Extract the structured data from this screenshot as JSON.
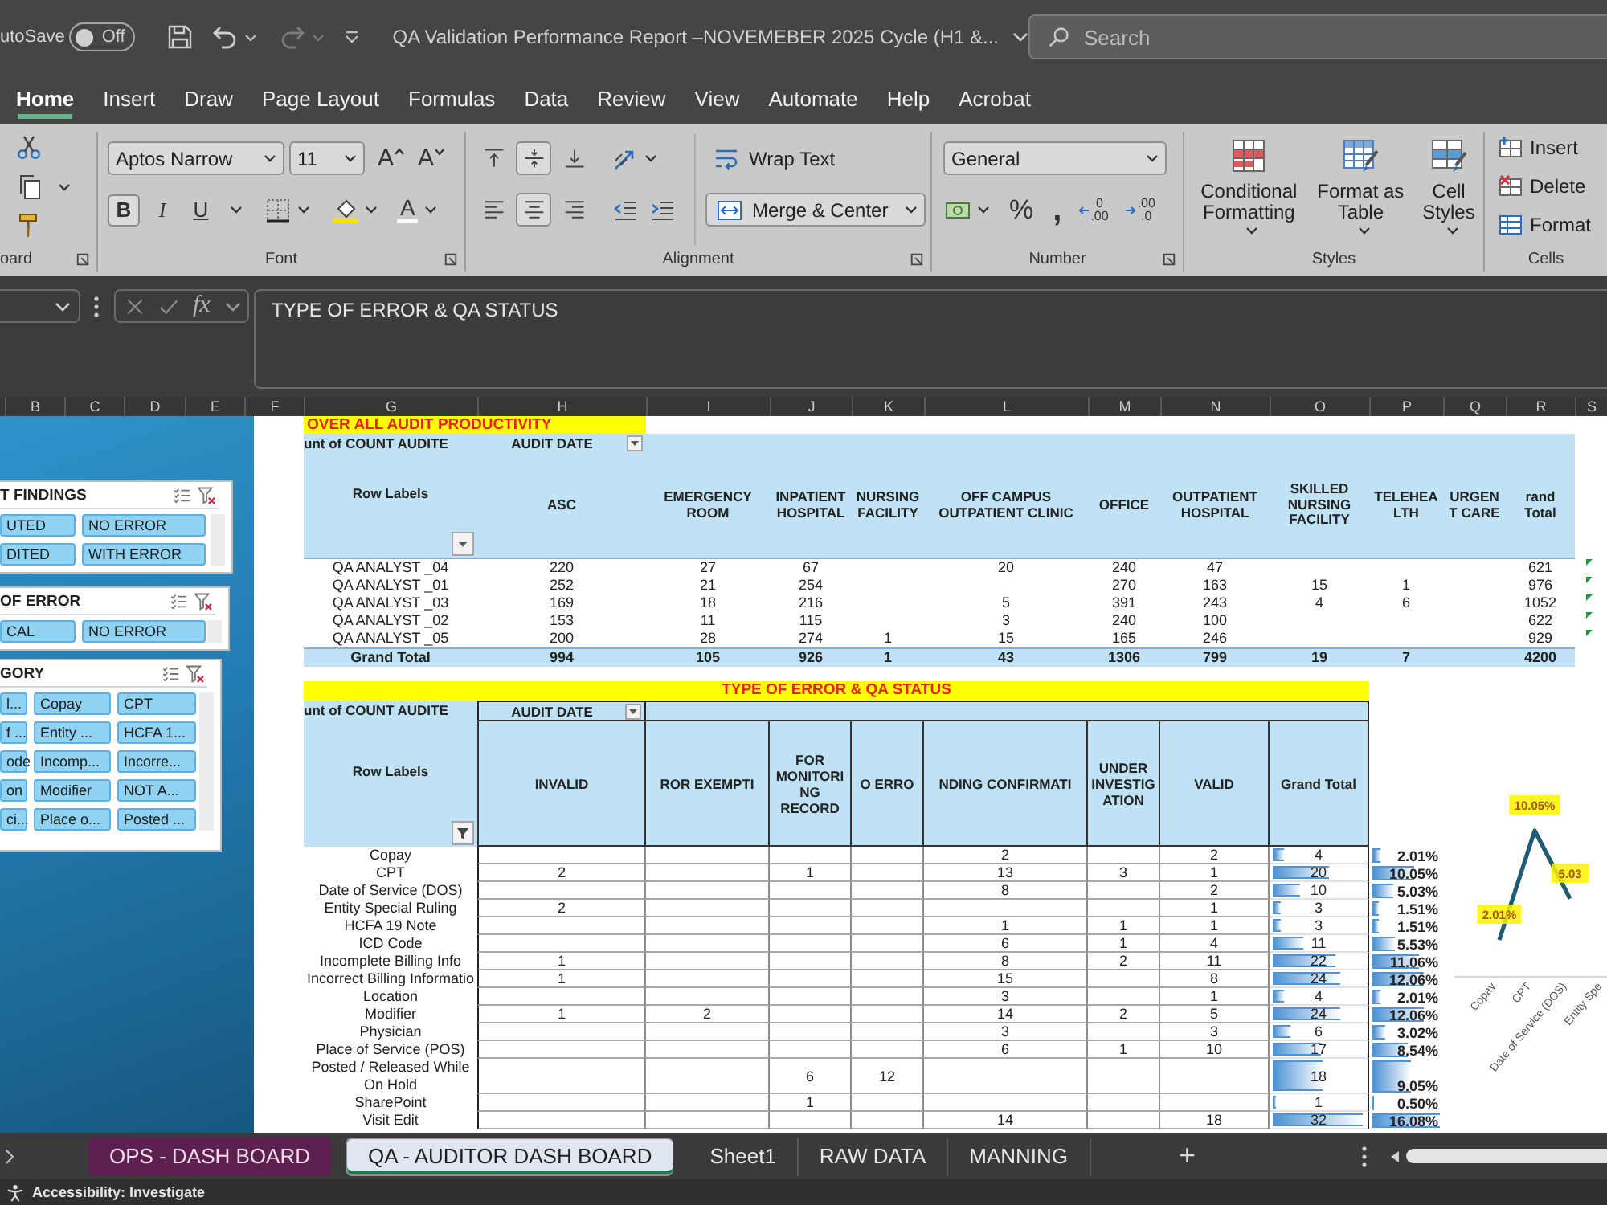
{
  "title_bar": {
    "autosave": "utoSave",
    "autosave_toggle": {
      "label": "Off",
      "on": false
    },
    "title": "QA Validation Performance Report –NOVEMEBER 2025 Cycle (H1 &...",
    "search": {
      "placeholder": "Search"
    }
  },
  "ribbon_tabs": [
    {
      "label": "Home",
      "selected": true
    },
    {
      "label": "Insert",
      "selected": false
    },
    {
      "label": "Draw",
      "selected": false
    },
    {
      "label": "Page Layout",
      "selected": false
    },
    {
      "label": "Formulas",
      "selected": false
    },
    {
      "label": "Data",
      "selected": false
    },
    {
      "label": "Review",
      "selected": false
    },
    {
      "label": "View",
      "selected": false
    },
    {
      "label": "Automate",
      "selected": false
    },
    {
      "label": "Help",
      "selected": false
    },
    {
      "label": "Acrobat",
      "selected": false
    }
  ],
  "ribbon": {
    "clipboard": {
      "label": "oard"
    },
    "font": {
      "label": "Font",
      "font_name": "Aptos Narrow",
      "font_size": "11",
      "size_buttons": [
        {
          "kind": "grow",
          "label": "A"
        },
        {
          "kind": "shrink",
          "label": "A"
        }
      ],
      "style_buttons": [
        {
          "kind": "bold",
          "label": "B",
          "selected": true
        },
        {
          "kind": "italic",
          "label": "I",
          "selected": false
        },
        {
          "kind": "underline",
          "label": "U",
          "selected": false
        }
      ],
      "font_color": "A"
    },
    "alignment": {
      "label": "Alignment",
      "vertical_buttons": [
        {
          "kind": "top",
          "selected": false
        },
        {
          "kind": "middle",
          "selected": true
        },
        {
          "kind": "bottom",
          "selected": false
        }
      ],
      "horizontal_buttons": [
        {
          "kind": "left",
          "selected": false
        },
        {
          "kind": "center",
          "selected": true
        },
        {
          "kind": "right",
          "selected": false
        }
      ],
      "wrap_text": {
        "label": "Wrap Text",
        "selected": false
      },
      "merge_center": {
        "label": "Merge & Center",
        "selected": true
      }
    },
    "number": {
      "label": "Number",
      "format": "General",
      "percent": "%",
      "comma": ",",
      "decimal_buttons": [
        {
          "kind": "increase",
          "lines": [
            "0",
            ".00"
          ]
        },
        {
          "kind": "decrease",
          "lines": [
            ".00",
            ".0"
          ]
        }
      ]
    },
    "styles": {
      "label": "Styles",
      "buttons": [
        {
          "kind": "conditional",
          "label": "Conditional Formatting"
        },
        {
          "kind": "table",
          "label": "Format as Table"
        },
        {
          "kind": "cell_styles",
          "label": "Cell Styles"
        }
      ]
    },
    "cells": {
      "label": "Cells",
      "buttons": [
        {
          "kind": "insert",
          "label": "Insert"
        },
        {
          "kind": "delete",
          "label": "Delete"
        },
        {
          "kind": "format",
          "label": "Format"
        }
      ]
    }
  },
  "formula_bar": {
    "function_label": "fx",
    "formula": "TYPE OF ERROR & QA STATUS"
  },
  "column_headers": [
    "B",
    "C",
    "D",
    "E",
    "F",
    "G",
    "H",
    "I",
    "J",
    "K",
    "L",
    "M",
    "N",
    "O",
    "P",
    "Q",
    "R",
    "S"
  ],
  "slicers": [
    {
      "title": "T FINDINGS",
      "rows": [
        [
          {
            "label": "UTED",
            "selected": true
          },
          {
            "label": "NO ERROR",
            "selected": true
          }
        ],
        [
          {
            "label": "DITED",
            "selected": true
          },
          {
            "label": "WITH ERROR",
            "selected": true
          }
        ]
      ]
    },
    {
      "title": "OF ERROR",
      "rows": [
        [
          {
            "label": "CAL",
            "selected": true
          },
          {
            "label": "NO ERROR",
            "selected": true
          }
        ]
      ]
    },
    {
      "title": "GORY",
      "rows": [
        [
          {
            "label": "l...",
            "selected": true
          },
          {
            "label": "Copay",
            "selected": true
          },
          {
            "label": "CPT",
            "selected": true
          }
        ],
        [
          {
            "label": "f ...",
            "selected": true
          },
          {
            "label": "Entity ...",
            "selected": true
          },
          {
            "label": "HCFA 1...",
            "selected": true
          }
        ],
        [
          {
            "label": "ode",
            "selected": true
          },
          {
            "label": "Incomp...",
            "selected": true
          },
          {
            "label": "Incorre...",
            "selected": true
          }
        ],
        [
          {
            "label": "on",
            "selected": true
          },
          {
            "label": "Modifier",
            "selected": true
          },
          {
            "label": "NOT A...",
            "selected": true
          }
        ],
        [
          {
            "label": "ci...",
            "selected": true
          },
          {
            "label": "Place o...",
            "selected": true
          },
          {
            "label": "Posted ...",
            "selected": true
          }
        ]
      ]
    }
  ],
  "upper_pivot": {
    "title": "OVER ALL AUDIT PRODUCTIVITY",
    "value_field": "unt of COUNT AUDITE",
    "column_field": "AUDIT DATE",
    "row_header": "Row Labels",
    "columns": [
      "ASC",
      "EMERGENCY ROOM",
      "INPATIENT HOSPITAL",
      "NURSING FACILITY",
      "OFF CAMPUS OUTPATIENT CLINIC",
      "OFFICE",
      "OUTPATIENT HOSPITAL",
      "SKILLED NURSING FACILITY",
      "TELEHEALTH",
      "URGENT CARE",
      "rand Total"
    ],
    "rows": [
      {
        "label": "QA ANALYST _04",
        "cells": [
          "220",
          "27",
          "67",
          null,
          "20",
          "240",
          "47",
          null,
          null,
          null,
          "621"
        ],
        "flagged": true
      },
      {
        "label": "QA ANALYST _01",
        "cells": [
          "252",
          "21",
          "254",
          null,
          null,
          "270",
          "163",
          "15",
          "1",
          null,
          "976"
        ],
        "flagged": true
      },
      {
        "label": "QA ANALYST _03",
        "cells": [
          "169",
          "18",
          "216",
          null,
          "5",
          "391",
          "243",
          "4",
          "6",
          null,
          "1052"
        ],
        "flagged": true
      },
      {
        "label": "QA ANALYST _02",
        "cells": [
          "153",
          "11",
          "115",
          null,
          "3",
          "240",
          "100",
          null,
          null,
          null,
          "622"
        ],
        "flagged": true
      },
      {
        "label": "QA ANALYST _05",
        "cells": [
          "200",
          "28",
          "274",
          "1",
          "15",
          "165",
          "246",
          null,
          null,
          null,
          "929"
        ],
        "flagged": true
      }
    ],
    "total": {
      "label": "Grand Total",
      "cells": [
        "994",
        "105",
        "926",
        "1",
        "43",
        "1306",
        "799",
        "19",
        "7",
        null,
        "4200"
      ]
    }
  },
  "lower_pivot": {
    "title": "TYPE OF ERROR & QA STATUS",
    "value_field": "unt of COUNT AUDITE",
    "column_field": "AUDIT DATE",
    "row_header": "Row Labels",
    "columns": [
      "INVALID",
      "ROR EXEMPTI",
      "FOR MONITORING RECORD",
      "O ERRO",
      "NDING CONFIRMATI",
      "UNDER INVESTIGATION",
      "VALID",
      "Grand Total"
    ],
    "rows": [
      {
        "label": "Copay",
        "cells": [
          null,
          null,
          null,
          null,
          "2",
          null,
          "2"
        ],
        "total": "4",
        "percent": "2.01%",
        "level": 0.13
      },
      {
        "label": "CPT",
        "cells": [
          "2",
          null,
          "1",
          null,
          "13",
          "3",
          "1"
        ],
        "total": "20",
        "percent": "10.05%",
        "level": 0.63
      },
      {
        "label": "Date of Service (DOS)",
        "cells": [
          null,
          null,
          null,
          null,
          "8",
          null,
          "2"
        ],
        "total": "10",
        "percent": "5.03%",
        "level": 0.31
      },
      {
        "label": "Entity Special Ruling",
        "cells": [
          "2",
          null,
          null,
          null,
          null,
          null,
          "1"
        ],
        "total": "3",
        "percent": "1.51%",
        "level": 0.09
      },
      {
        "label": "HCFA 19 Note",
        "cells": [
          null,
          null,
          null,
          null,
          "1",
          "1",
          "1"
        ],
        "total": "3",
        "percent": "1.51%",
        "level": 0.09
      },
      {
        "label": "ICD Code",
        "cells": [
          null,
          null,
          null,
          null,
          "6",
          "1",
          "4"
        ],
        "total": "11",
        "percent": "5.53%",
        "level": 0.34
      },
      {
        "label": "Incomplete Billing Info",
        "cells": [
          "1",
          null,
          null,
          null,
          "8",
          "2",
          "11"
        ],
        "total": "22",
        "percent": "11.06%",
        "level": 0.69
      },
      {
        "label": "Incorrect Billing Informatio",
        "cells": [
          "1",
          null,
          null,
          null,
          "15",
          null,
          "8"
        ],
        "total": "24",
        "percent": "12.06%",
        "level": 0.75
      },
      {
        "label": "Location",
        "cells": [
          null,
          null,
          null,
          null,
          "3",
          null,
          "1"
        ],
        "total": "4",
        "percent": "2.01%",
        "level": 0.13
      },
      {
        "label": "Modifier",
        "cells": [
          "1",
          "2",
          null,
          null,
          "14",
          "2",
          "5"
        ],
        "total": "24",
        "percent": "12.06%",
        "level": 0.75
      },
      {
        "label": "Physician",
        "cells": [
          null,
          null,
          null,
          null,
          "3",
          null,
          "3"
        ],
        "total": "6",
        "percent": "3.02%",
        "level": 0.19
      },
      {
        "label": "Place of Service (POS)",
        "cells": [
          null,
          null,
          null,
          null,
          "6",
          "1",
          "10"
        ],
        "total": "17",
        "percent": "8.54%",
        "level": 0.53
      },
      {
        "label": "Posted / Released While On Hold",
        "cells": [
          null,
          null,
          "6",
          "12",
          null,
          null,
          null
        ],
        "total": "18",
        "percent": "9.05%",
        "level": 0.56
      },
      {
        "label": "SharePoint",
        "cells": [
          null,
          null,
          "1",
          null,
          null,
          null,
          null
        ],
        "total": "1",
        "percent": "0.50%",
        "level": 0.03
      },
      {
        "label": "Visit Edit",
        "cells": [
          null,
          null,
          null,
          null,
          "14",
          null,
          "18"
        ],
        "total": "32",
        "percent": "16.08%",
        "level": 1.0
      }
    ]
  },
  "chart": {
    "chart_data": [
      {
        "type": "line",
        "categories": [
          "Copay",
          "CPT",
          "Date of Service (DOS)",
          "Entity Spe"
        ],
        "values": [
          2.01,
          10.05,
          5.03,
          null
        ],
        "value_labels": [
          "2.01%",
          "10.05%",
          "5.03",
          null
        ],
        "color": "#1f5b73"
      }
    ]
  },
  "sheet_tabs": [
    {
      "label": "OPS - DASH BOARD",
      "selected": false,
      "color": "#5c1f50"
    },
    {
      "label": "QA - AUDITOR DASH BOARD",
      "selected": true
    },
    {
      "label": "Sheet1",
      "selected": false
    },
    {
      "label": "RAW DATA",
      "selected": false
    },
    {
      "label": "MANNING",
      "selected": false
    }
  ],
  "add_sheet": "+",
  "status_bar": {
    "accessibility": "Accessibility: Investigate"
  }
}
